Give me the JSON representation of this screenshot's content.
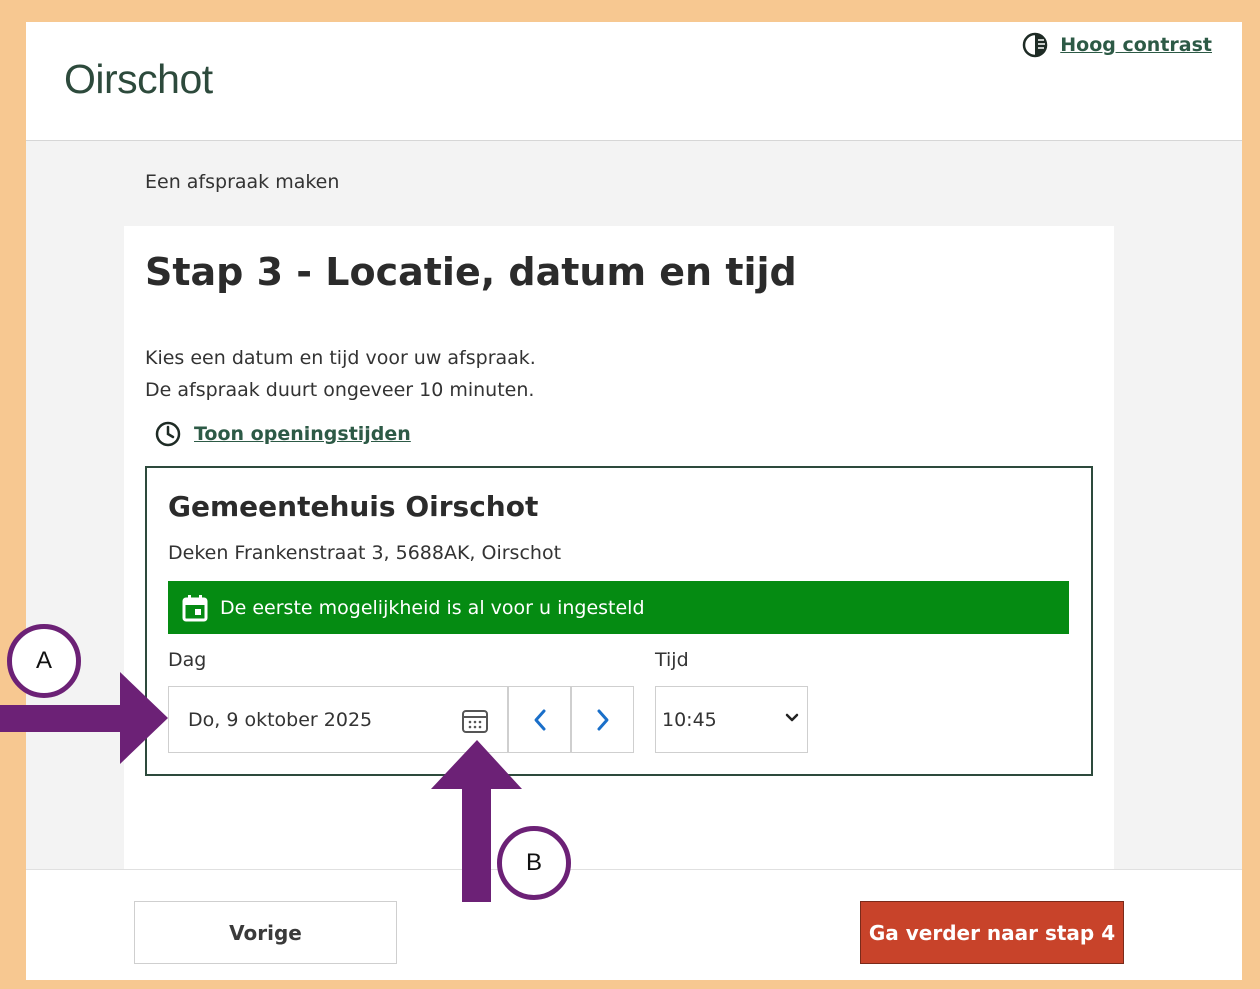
{
  "header": {
    "logo_text": "Oirschot",
    "contrast_link": "Hoog contrast"
  },
  "breadcrumb": "Een afspraak maken",
  "step": {
    "title": "Stap 3 - Locatie, datum en tijd",
    "intro_line1": "Kies een datum en tijd voor uw afspraak.",
    "intro_line2": "De afspraak duurt ongeveer 10 minuten.",
    "hours_link": "Toon openingstijden"
  },
  "location": {
    "name": "Gemeentehuis Oirschot",
    "address": "Deken Frankenstraat 3, 5688AK, Oirschot",
    "notice": "De eerste mogelijkheid is al voor u ingesteld",
    "day_label": "Dag",
    "day_value": "Do, 9 oktober 2025",
    "time_label": "Tijd",
    "time_value": "10:45"
  },
  "footer": {
    "prev_label": "Vorige",
    "next_label": "Ga verder naar stap 4"
  },
  "annotations": {
    "marker_a": "A",
    "marker_b": "B"
  },
  "colors": {
    "brand_green": "#2d4a3c",
    "notice_green": "#058b12",
    "cta_red": "#c8432a",
    "annotation_purple": "#6c2176",
    "frame_orange": "#f7c891",
    "link_blue": "#1a6fc9"
  }
}
